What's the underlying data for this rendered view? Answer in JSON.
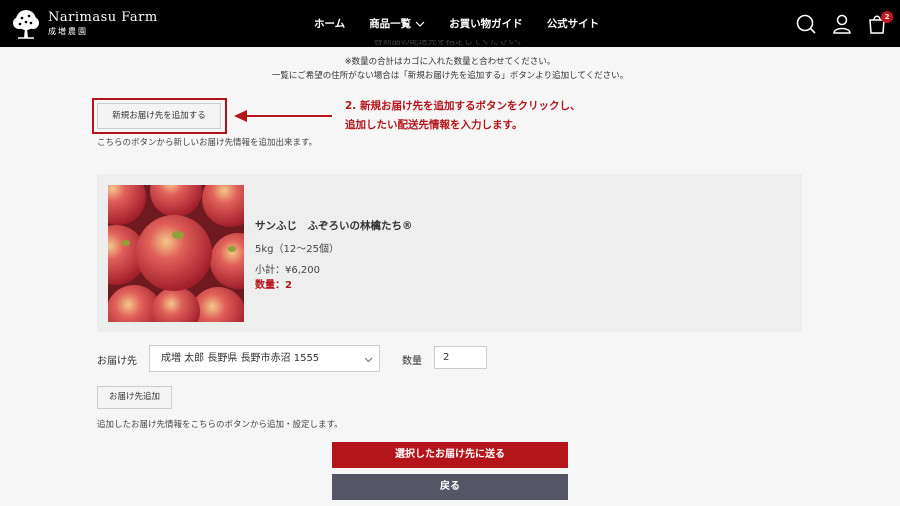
{
  "header": {
    "logo": {
      "title": "Narimasu Farm",
      "subtitle": "成増農園"
    },
    "nav": [
      {
        "label": "ホーム"
      },
      {
        "label": "商品一覧"
      },
      {
        "label": "お買い物ガイド"
      },
      {
        "label": "公式サイト"
      }
    ],
    "cart_count": "2",
    "icons": [
      "search-icon",
      "user-icon",
      "cart-icon"
    ]
  },
  "notes": {
    "clipped": "各商品の配送先を指定してください。",
    "line1": "※数量の合計はカゴに入れた数量と合わせてください。",
    "line2": "一覧にご希望の住所がない場合は「新規お届け先を追加する」ボタンより追加してください。"
  },
  "new_address_button": "新規お届け先を追加する",
  "annotation": {
    "line1": "2. 新規お届け先を追加するボタンをクリックし、",
    "line2": "追加したい配送先情報を入力します。"
  },
  "new_address_helper": "こちらのボタンから新しいお届け先情報を追加出来ます。",
  "product": {
    "name": "サンふじ　ふぞろいの林檎たち®",
    "spec": "5kg（12〜25個）",
    "subtotal": "小計：¥6,200",
    "quantity": "数量：2"
  },
  "form": {
    "delivery_label": "お届け先",
    "delivery_value": "成増 太郎 長野県 長野市赤沼 1555",
    "qty_label": "数量",
    "qty_value": "2",
    "add_button": "お届け先追加",
    "add_helper": "追加したお届け先情報をこちらのボタンから追加・設定します。"
  },
  "actions": {
    "send": "選択したお届け先に送る",
    "back": "戻る"
  },
  "colors": {
    "header_bg": "#000000",
    "accent_red": "#b3151b",
    "back_button": "#555665",
    "page_bg": "#f6f6f6"
  }
}
